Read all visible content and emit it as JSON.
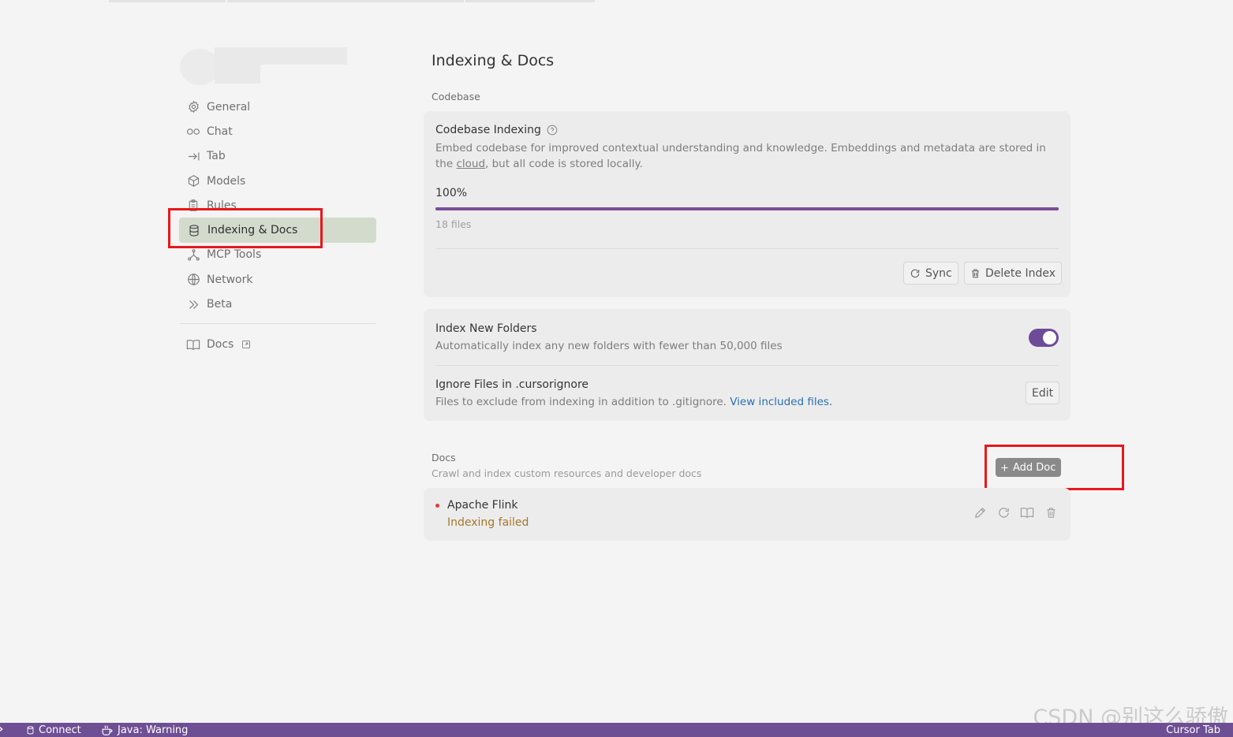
{
  "sidebar": {
    "items": [
      {
        "label": "General",
        "icon": "gear-icon"
      },
      {
        "label": "Chat",
        "icon": "infinity-icon"
      },
      {
        "label": "Tab",
        "icon": "arrow-right-bar-icon"
      },
      {
        "label": "Models",
        "icon": "cube-icon"
      },
      {
        "label": "Rules",
        "icon": "clipboard-icon"
      },
      {
        "label": "Indexing & Docs",
        "icon": "database-icon",
        "active": true
      },
      {
        "label": "MCP Tools",
        "icon": "nodes-icon"
      },
      {
        "label": "Network",
        "icon": "globe-icon"
      },
      {
        "label": "Beta",
        "icon": "chevrons-right-icon"
      }
    ],
    "docs_link": {
      "label": "Docs",
      "icon": "book-icon",
      "external_icon": "external-link-icon"
    }
  },
  "main": {
    "title": "Indexing & Docs",
    "codebase_section_label": "Codebase",
    "codebase_card": {
      "title": "Codebase Indexing",
      "desc_before_link": "Embed codebase for improved contextual understanding and knowledge. Embeddings and metadata are stored in the ",
      "desc_link": "cloud",
      "desc_after_link": ", but all code is stored locally.",
      "progress_label": "100%",
      "progress_value": 1.0,
      "files_count": "18 files",
      "sync_label": "Sync",
      "delete_label": "Delete Index"
    },
    "folders_card": {
      "index_new_title": "Index New Folders",
      "index_new_desc": "Automatically index any new folders with fewer than 50,000 files",
      "index_new_enabled": true,
      "ignore_title": "Ignore Files in .cursorignore",
      "ignore_desc": "Files to exclude from indexing in addition to .gitignore. ",
      "ignore_link": "View included files.",
      "edit_label": "Edit"
    },
    "docs_section": {
      "label": "Docs",
      "desc": "Crawl and index custom resources and developer docs",
      "add_label": "Add Doc",
      "items": [
        {
          "name": "Apache Flink",
          "status": "Indexing failed"
        }
      ]
    }
  },
  "statusbar": {
    "connect": "Connect",
    "java": "Java: Warning",
    "right": "Cursor Tab"
  },
  "watermark": "CSDN @别这么骄傲",
  "colors": {
    "accent": "#6e4f93",
    "highlight_box": "#e8171b",
    "active_nav": "#d3dbcd",
    "failed": "#a6762a",
    "link": "#2b6fb5"
  }
}
